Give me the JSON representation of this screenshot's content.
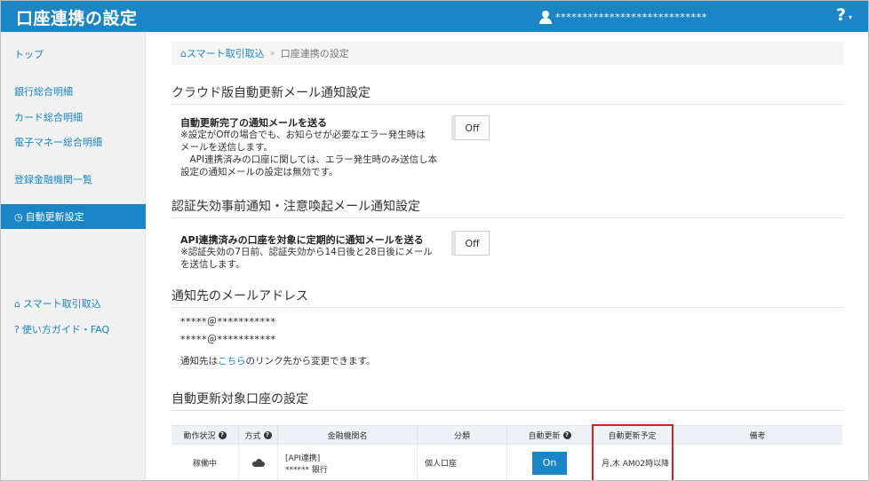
{
  "header": {
    "title": "口座連携の設定",
    "user_masked": "****************************",
    "help_label": "?",
    "help_caret": "▾"
  },
  "sidebar": {
    "items": [
      {
        "label": "トップ"
      },
      {
        "label": "銀行総合明細"
      },
      {
        "label": "カード総合明細"
      },
      {
        "label": "電子マネー総合明細"
      },
      {
        "label": "登録金融機関一覧"
      },
      {
        "label": "自動更新設定",
        "icon": "clock-icon",
        "glyph": "◷"
      },
      {
        "label": "スマート取引取込",
        "icon": "home-icon",
        "glyph": "⌂"
      },
      {
        "label": "使い方ガイド・FAQ",
        "icon": "question-circle-icon",
        "glyph": "?"
      }
    ]
  },
  "breadcrumb": {
    "home_glyph": "⌂",
    "home_label": "スマート取引取込",
    "separator": "»",
    "current": "口座連携の設定"
  },
  "sections": {
    "cloud_mail": {
      "title": "クラウド版自動更新メール通知設定",
      "setting_title": "自動更新完了の通知メールを送る",
      "desc_lines": [
        "※設定がOffの場合でも、お知らせが必要なエラー発生時は",
        "メールを送信します。",
        "　API連携済みの口座に関しては、エラー発生時のみ送信し本",
        "設定の通知メールの設定は無効です。"
      ],
      "toggle_label": "Off"
    },
    "auth_mail": {
      "title": "認証失効事前通知・注意喚起メール通知設定",
      "setting_title": "API連携済みの口座を対象に定期的に通知メールを送る",
      "desc_lines": [
        "※認証失効の7日前、認証失効から14日後と28日後にメール",
        "を送信します。"
      ],
      "toggle_label": "Off"
    },
    "email": {
      "title": "通知先のメールアドレス",
      "addresses": [
        "*****＠***********",
        "*****＠***********"
      ],
      "note_prefix": "通知先は",
      "note_link": "こちら",
      "note_suffix": "のリンク先から変更できます。"
    },
    "accounts": {
      "title": "自動更新対象口座の設定",
      "columns": [
        "動作状況",
        "方式",
        "金融機関名",
        "分類",
        "自動更新",
        "自動更新予定",
        "備考"
      ],
      "help_glyph": "?",
      "rows": [
        {
          "status": "稼働中",
          "method_icon": "cloud-icon",
          "institution_tag": "[API連携]",
          "institution_name": "****** 銀行",
          "category": "個人口座",
          "auto_update": "On",
          "schedule": "月,木 AM02時以降",
          "remarks": ""
        }
      ]
    }
  },
  "colors": {
    "header_bg": "#1a86c8",
    "link": "#1a86c8",
    "sidebar_bg": "#f1f1f1",
    "highlight_border": "#d91e1e"
  }
}
